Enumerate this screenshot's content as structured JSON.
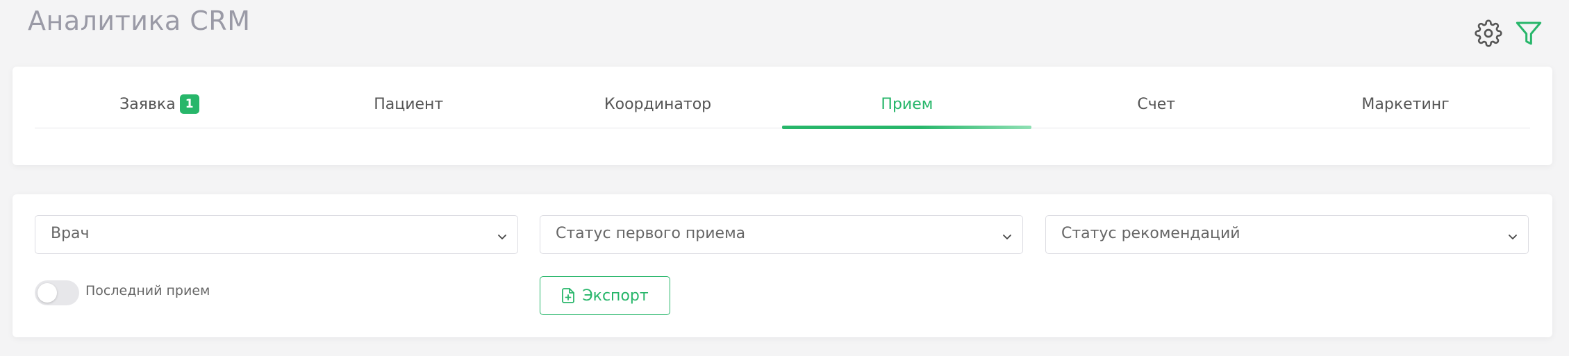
{
  "page": {
    "title": "Аналитика CRM"
  },
  "top_icons": [
    "gear-icon",
    "filter-icon"
  ],
  "tabs": [
    {
      "label": "Заявка",
      "badge": "1"
    },
    {
      "label": "Пациент"
    },
    {
      "label": "Координатор"
    },
    {
      "label": "Прием",
      "active": true
    },
    {
      "label": "Счет"
    },
    {
      "label": "Маркетинг"
    }
  ],
  "filters": {
    "doctor": {
      "label": "Врач"
    },
    "first_visit_status": {
      "label": "Статус первого приема"
    },
    "recommendation_status": {
      "label": "Статус рекомендаций"
    },
    "last_visit_toggle": {
      "label": "Последний прием",
      "checked": false
    },
    "export": {
      "label": "Экспорт",
      "icon": "file-plus-icon"
    }
  },
  "colors": {
    "accent": "#27b66a",
    "background": "#f4f4f5",
    "title": "#9a9aa6"
  }
}
